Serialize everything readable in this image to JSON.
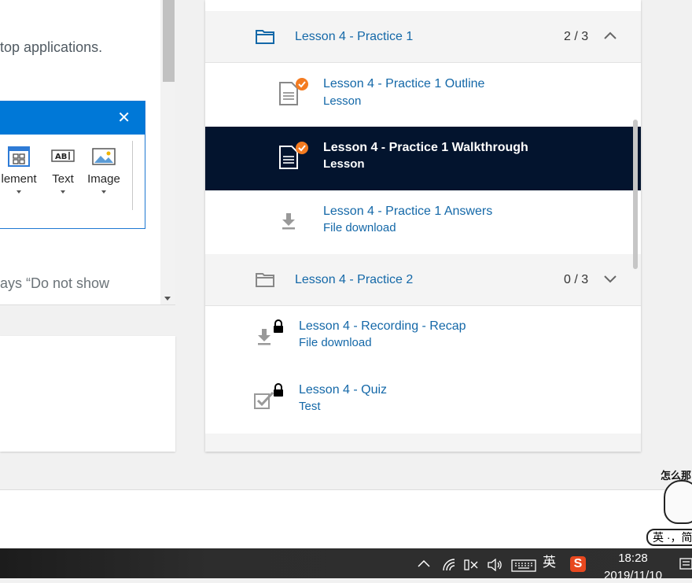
{
  "left_panel": {
    "text_line_1": "top applications.",
    "text_line_2": "ays “Do not show"
  },
  "ribbon": {
    "tools": [
      {
        "label": "Element",
        "display": "lement",
        "icon": "element-grid-icon"
      },
      {
        "label": "Text",
        "display": "Text",
        "icon": "text-box-icon"
      },
      {
        "label": "Image",
        "display": "Image",
        "icon": "image-icon"
      }
    ],
    "close_icon": "close-icon"
  },
  "lessons": {
    "sections": [
      {
        "title": "Lesson 4 - Practice 1",
        "count": "2 / 3",
        "expanded": true
      },
      {
        "title": "Lesson 4 - Practice 2",
        "count": "0 / 3",
        "expanded": false
      }
    ],
    "items": [
      {
        "title": "Lesson 4 - Practice 1 Outline",
        "type": "Lesson",
        "icon": "document-icon",
        "status": "completed"
      },
      {
        "title": "Lesson 4 - Practice 1 Walkthrough",
        "type": "Lesson",
        "icon": "document-icon",
        "status": "completed",
        "active": true
      },
      {
        "title": "Lesson 4 - Practice 1 Answers",
        "type": "File download",
        "icon": "download-icon"
      },
      {
        "title": "Lesson 4 - Recording - Recap",
        "type": "File download",
        "icon": "download-icon",
        "status": "locked"
      },
      {
        "title": "Lesson 4 - Quiz",
        "type": "Test",
        "icon": "checkbox-icon",
        "status": "locked"
      }
    ],
    "colors": {
      "link": "#1468a8",
      "active_bg": "#03142e",
      "complete": "#f47b20"
    }
  },
  "sticker": {
    "top_text": "怎么那",
    "bubble_text": "英 ·，简"
  },
  "taskbar": {
    "ime_label": "英",
    "ime_app": "S",
    "time": "18:28",
    "date": "2019/11/10"
  }
}
